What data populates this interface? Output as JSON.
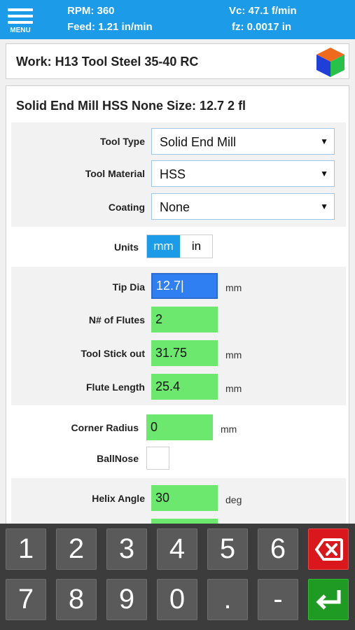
{
  "topbar": {
    "menu_label": "MENU",
    "rpm": "RPM: 360",
    "vc": "Vc: 47.1 f/min",
    "feed": "Feed: 1.21 in/min",
    "fz": "fz: 0.0017 in"
  },
  "work": {
    "title": "Work: H13 Tool Steel 35-40 RC"
  },
  "tool": {
    "title": "Solid End Mill HSS None Size: 12.7 2 fl",
    "tool_type_label": "Tool Type",
    "tool_type_value": "Solid End Mill",
    "tool_material_label": "Tool Material",
    "tool_material_value": "HSS",
    "coating_label": "Coating",
    "coating_value": "None",
    "units_label": "Units",
    "units_mm": "mm",
    "units_in": "in",
    "tip_dia_label": "Tip Dia",
    "tip_dia_value": "12.7|",
    "tip_dia_unit": "mm",
    "flutes_label": "N# of Flutes",
    "flutes_value": "2",
    "stick_out_label": "Tool Stick out",
    "stick_out_value": "31.75",
    "stick_out_unit": "mm",
    "flute_length_label": "Flute Length",
    "flute_length_value": "25.4",
    "flute_length_unit": "mm",
    "corner_radius_label": "Corner Radius",
    "corner_radius_value": "0",
    "corner_radius_unit": "mm",
    "ballnose_label": "BallNose",
    "helix_label": "Helix Angle",
    "helix_value": "30",
    "helix_unit": "deg"
  },
  "keypad": {
    "k1": "1",
    "k2": "2",
    "k3": "3",
    "k4": "4",
    "k5": "5",
    "k6": "6",
    "k7": "7",
    "k8": "8",
    "k9": "9",
    "k0": "0",
    "kdot": ".",
    "kminus": "-"
  },
  "colors": {
    "accent": "#1c9be8",
    "field_green": "#6ce86e",
    "active_blue": "#2f7ff2",
    "delete_red": "#d9171c",
    "enter_green": "#1f9b23"
  }
}
